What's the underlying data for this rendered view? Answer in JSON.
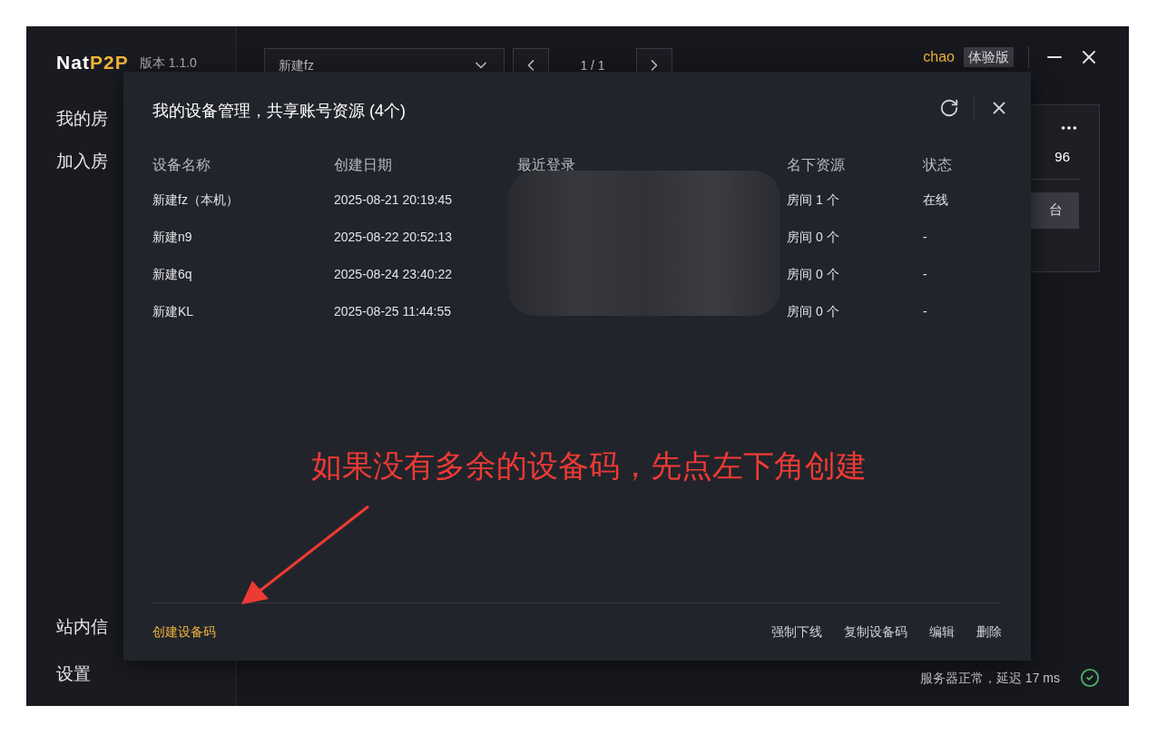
{
  "app": {
    "logo": {
      "part1": "Nat",
      "part2": "P2P"
    },
    "version": "版本 1.1.0"
  },
  "sidebar": {
    "items": [
      "我的房",
      "加入房"
    ],
    "bottom_items": [
      "站内信",
      "设置"
    ]
  },
  "topbar": {
    "device_select": "新建fz",
    "page": "1 / 1",
    "user": "chao",
    "badge": "体验版"
  },
  "background_card": {
    "value": "96",
    "button": "台"
  },
  "dialog": {
    "title": "我的设备管理，共享账号资源 (4个)",
    "columns": [
      "设备名称",
      "创建日期",
      "最近登录",
      "名下资源",
      "状态"
    ],
    "rows": [
      {
        "name": "新建fz（本机）",
        "created": "2025-08-21 20:19:45",
        "resources": "房间 1 个",
        "status": "在线"
      },
      {
        "name": "新建n9",
        "created": "2025-08-22 20:52:13",
        "resources": "房间 0 个",
        "status": "-"
      },
      {
        "name": "新建6q",
        "created": "2025-08-24 23:40:22",
        "resources": "房间 0 个",
        "status": "-"
      },
      {
        "name": "新建KL",
        "created": "2025-08-25 11:44:55",
        "resources": "房间 0 个",
        "status": "-"
      }
    ],
    "footer_left": "创建设备码",
    "footer_actions": [
      "强制下线",
      "复制设备码",
      "编辑",
      "删除"
    ]
  },
  "annotation": {
    "text": "如果没有多余的设备码，先点左下角创建"
  },
  "status_bar": {
    "text": "服务器正常，延迟 17 ms",
    "ok": true
  }
}
